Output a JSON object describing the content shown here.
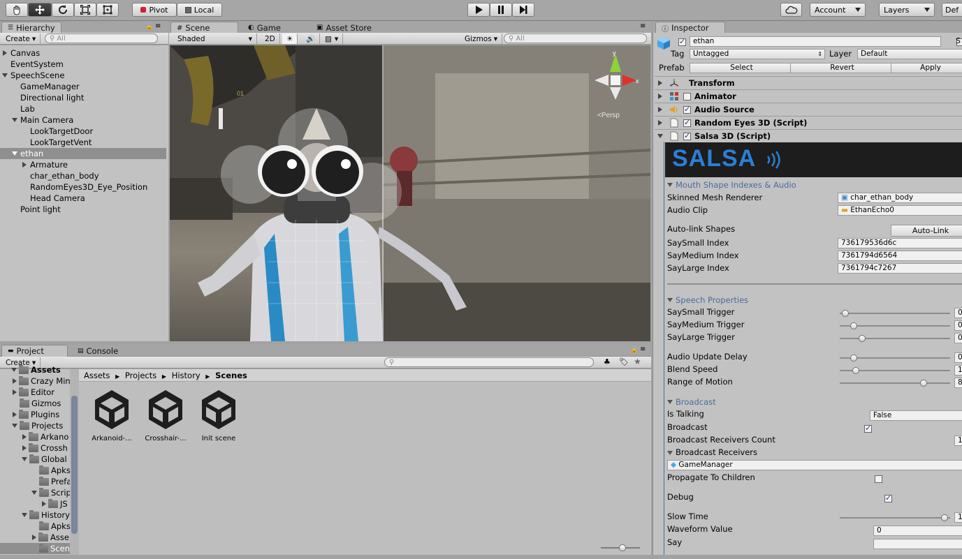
{
  "toolbar": {
    "pivot_label": "Pivot",
    "local_label": "Local",
    "account_label": "Account",
    "layers_label": "Layers",
    "layout_label": "Def"
  },
  "hierarchy": {
    "tab_label": "Hierarchy",
    "create_label": "Create",
    "search_placeholder": "All",
    "items": [
      {
        "label": "Canvas"
      },
      {
        "label": "EventSystem"
      },
      {
        "label": "SpeechScene"
      },
      {
        "label": "GameManager"
      },
      {
        "label": "Directional light"
      },
      {
        "label": "Lab"
      },
      {
        "label": "Main Camera"
      },
      {
        "label": "LookTargetDoor"
      },
      {
        "label": "LookTargetVent"
      },
      {
        "label": "ethan"
      },
      {
        "label": "Armature"
      },
      {
        "label": "char_ethan_body"
      },
      {
        "label": "RandomEyes3D_Eye_Position"
      },
      {
        "label": "Head Camera"
      },
      {
        "label": "Point light"
      }
    ]
  },
  "scene": {
    "tabs": [
      "Scene",
      "Game",
      "Asset Store"
    ],
    "shading_mode": "Shaded",
    "mode_2d": "2D",
    "gizmos_label": "Gizmos",
    "search_placeholder": "All",
    "persp_label": "Persp",
    "axis_y": "y",
    "axis_x": "x",
    "scene_note": "01"
  },
  "project": {
    "tabs": [
      "Project",
      "Console"
    ],
    "create_label": "Create",
    "tree": [
      {
        "label": "Assets"
      },
      {
        "label": "Crazy Min"
      },
      {
        "label": "Editor"
      },
      {
        "label": "Gizmos"
      },
      {
        "label": "Plugins"
      },
      {
        "label": "Projects"
      },
      {
        "label": "Arkano"
      },
      {
        "label": "Crossh"
      },
      {
        "label": "Global"
      },
      {
        "label": "Apks"
      },
      {
        "label": "Prefa"
      },
      {
        "label": "Scrip"
      },
      {
        "label": "JS"
      },
      {
        "label": "History"
      },
      {
        "label": "Apks"
      },
      {
        "label": "Asse"
      },
      {
        "label": "Scen"
      }
    ],
    "breadcrumb": [
      "Assets",
      "Projects",
      "History",
      "Scenes"
    ],
    "assets": [
      {
        "label": "Arkanoid-..."
      },
      {
        "label": "Crosshair-..."
      },
      {
        "label": "Init scene"
      }
    ]
  },
  "inspector": {
    "tab_label": "Inspector",
    "object_name": "ethan",
    "static_label": "S",
    "tag_label": "Tag",
    "tag_value": "Untagged",
    "layer_label": "Layer",
    "layer_value": "Default",
    "prefab_label": "Prefab",
    "prefab_select": "Select",
    "prefab_revert": "Revert",
    "prefab_apply": "Apply",
    "components": [
      {
        "label": "Transform"
      },
      {
        "label": "Animator"
      },
      {
        "label": "Audio Source"
      },
      {
        "label": "Random Eyes 3D (Script)"
      },
      {
        "label": "Salsa 3D (Script)"
      }
    ],
    "salsa_logo": "SALSA",
    "mouth_section": "Mouth Shape Indexes & Audio",
    "skinned_label": "Skinned Mesh Renderer",
    "skinned_value": "char_ethan_body",
    "audioclip_label": "Audio Clip",
    "audioclip_value": "EthanEcho0",
    "autolink_label": "Auto-link Shapes",
    "autolink_button": "Auto-Link",
    "saysmall_index_label": "SaySmall Index",
    "saysmall_index_value": "736179536d6c",
    "saymedium_index_label": "SayMedium Index",
    "saymedium_index_value": "7361794d6564",
    "saylarge_index_label": "SayLarge Index",
    "saylarge_index_value": "7361794c7267",
    "speech_section": "Speech Properties",
    "saysmall_trigger_label": "SaySmall Trigger",
    "saysmall_trigger_value": "0",
    "saysmall_trigger_level": 0.02,
    "saymedium_trigger_label": "SayMedium Trigger",
    "saymedium_trigger_value": "0",
    "saymedium_trigger_level": 0.1,
    "saylarge_trigger_label": "SayLarge Trigger",
    "saylarge_trigger_value": "0",
    "saylarge_trigger_level": 0.18,
    "audio_delay_label": "Audio Update Delay",
    "audio_delay_value": "0",
    "audio_delay_level": 0.1,
    "blend_speed_label": "Blend Speed",
    "blend_speed_value": "1",
    "blend_speed_level": 0.12,
    "range_motion_label": "Range of Motion",
    "range_motion_value": "8",
    "range_motion_level": 0.78,
    "broadcast_section": "Broadcast",
    "is_talking_label": "Is Talking",
    "is_talking_value": "False",
    "broadcast_label": "Broadcast",
    "receivers_count_label": "Broadcast Receivers Count",
    "receivers_count_value": "1",
    "receivers_label": "Broadcast Receivers",
    "receiver_item": "GameManager",
    "propagate_label": "Propagate To Children",
    "debug_label": "Debug",
    "slow_time_label": "Slow Time",
    "slow_time_value": "1",
    "slow_time_level": 0.98,
    "waveform_label": "Waveform Value",
    "waveform_value": "0",
    "say_label": "Say"
  }
}
